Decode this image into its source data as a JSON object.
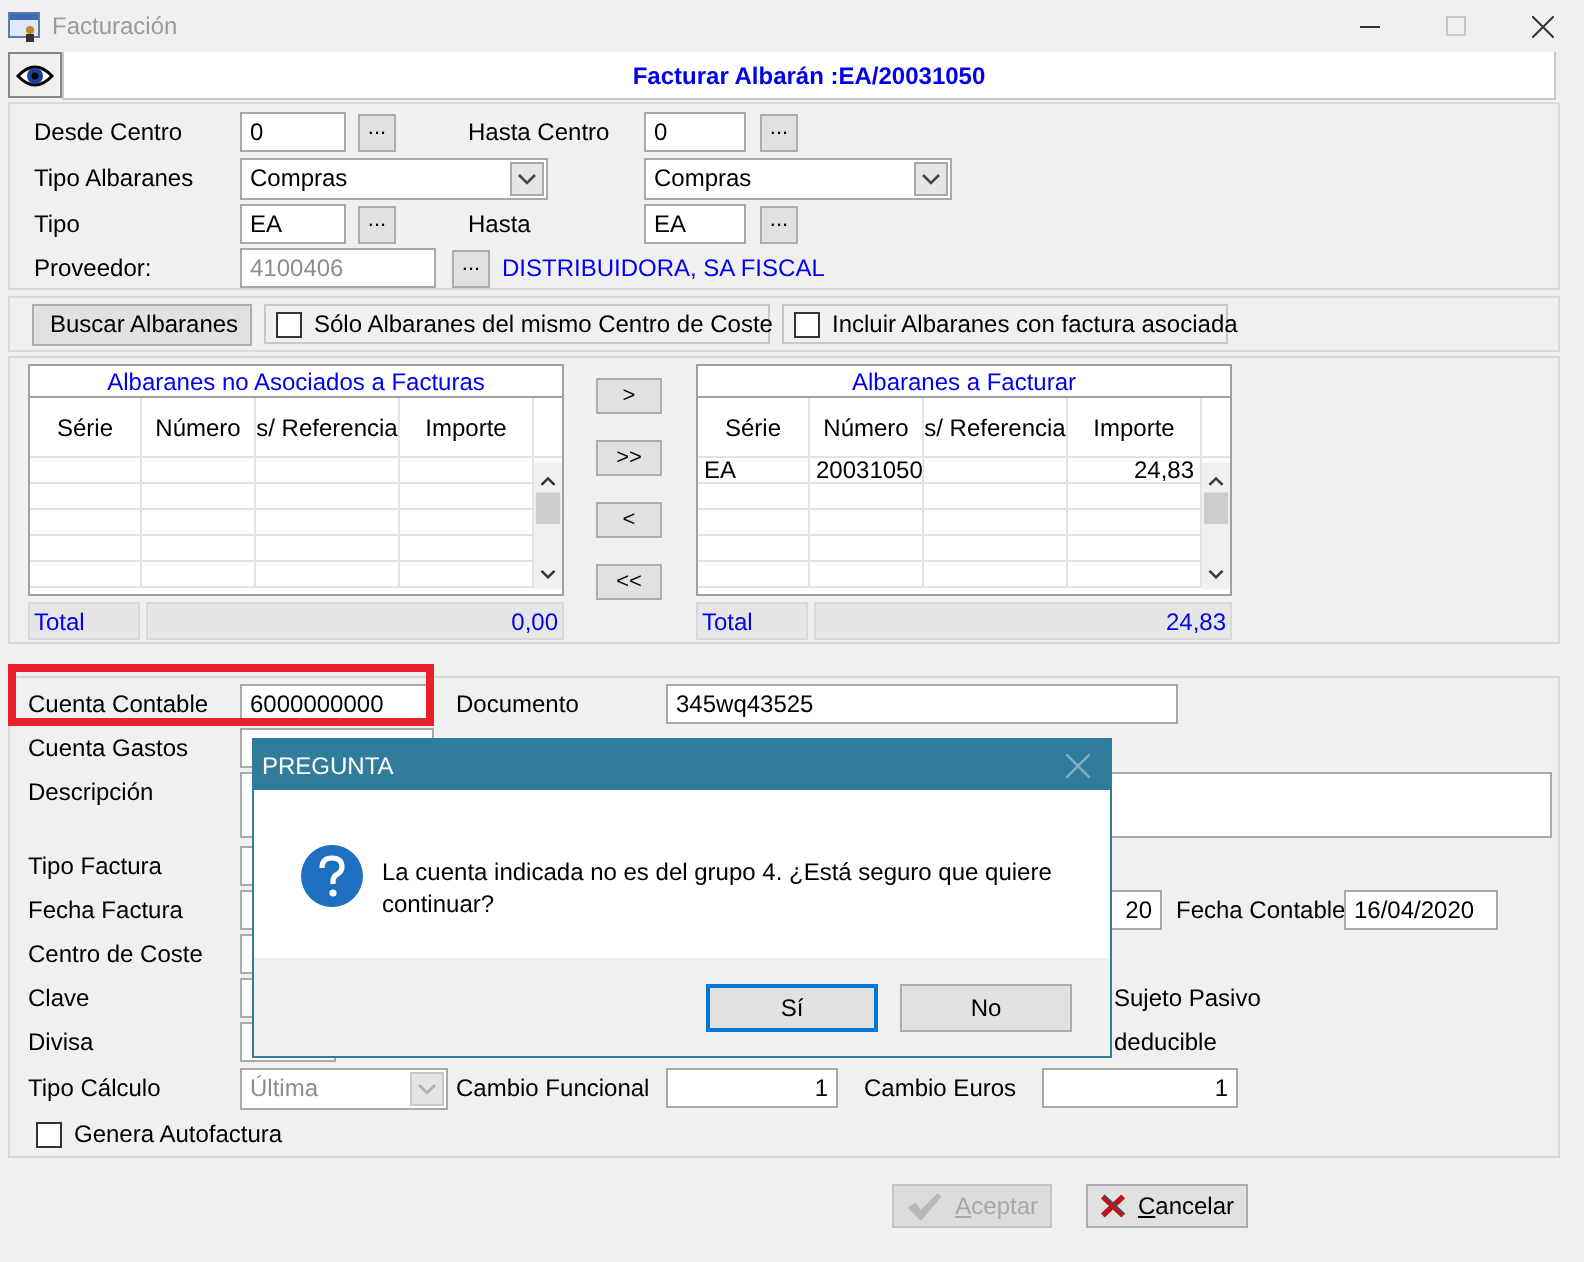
{
  "window": {
    "title": "Facturación"
  },
  "header": {
    "title": "Facturar Albarán :EA/20031050"
  },
  "filters": {
    "desde_centro": {
      "label": "Desde Centro",
      "value": "0",
      "button": "..."
    },
    "hasta_centro": {
      "label": "Hasta Centro",
      "value": "0",
      "button": "..."
    },
    "tipo_albaranes": {
      "label": "Tipo Albaranes",
      "value": "Compras"
    },
    "tipo_albaranes_hasta": {
      "value": "Compras"
    },
    "tipo": {
      "label": "Tipo",
      "value": "EA",
      "button": "..."
    },
    "hasta": {
      "label": "Hasta",
      "value": "EA",
      "button": "..."
    },
    "proveedor": {
      "label": "Proveedor:",
      "value": "4100406",
      "disabled": true,
      "button": "...",
      "name": "DISTRIBUIDORA, SA FISCAL"
    }
  },
  "search": {
    "button": "Buscar Albaranes",
    "options": [
      {
        "label": "Sólo Albaranes del mismo Centro de Coste",
        "checked": false
      },
      {
        "label": "Incluir Albaranes con factura asociada",
        "checked": false
      }
    ]
  },
  "lists": [
    {
      "title": "Albaranes no Asociados a Facturas",
      "columns": [
        "Série",
        "Número",
        "s/ Referencia",
        "Importe"
      ],
      "total_label": "Total",
      "total": "0,00"
    },
    {
      "title": "Albaranes a Facturar",
      "columns": [
        "Série",
        "Número",
        "s/ Referencia",
        "Importe"
      ],
      "rows": [
        {
          "serie": "EA",
          "numero": "20031050",
          "importe": "24,83"
        }
      ],
      "total_label": "Total",
      "total": "24,83"
    }
  ],
  "move_buttons": [
    ">",
    ">>",
    "<",
    "<<"
  ],
  "detail": {
    "cuenta_contable": {
      "label": "Cuenta Contable",
      "value": "6000000000",
      "highlighted": true
    },
    "documento": {
      "label": "Documento",
      "value": "345wq43525"
    },
    "cuenta_gastos": {
      "label": "Cuenta Gastos"
    },
    "descripcion": {
      "label": "Descripción"
    },
    "tipo_factura": {
      "label": "Tipo Factura"
    },
    "fecha_factura": {
      "label": "Fecha Factura"
    },
    "field_2": {
      "value": "20"
    },
    "fecha_contable": {
      "label": "Fecha Contable",
      "value": "16/04/2020"
    },
    "centro_de_coste": {
      "label": "Centro de Coste"
    },
    "clave": {
      "label": "Clave"
    },
    "option_1": {
      "label": "Sujeto Pasivo"
    },
    "divisa": {
      "label": "Divisa"
    },
    "option_2": {
      "label": "deducible"
    },
    "tipo_calculo": {
      "label": "Tipo Cálculo",
      "value": "Última",
      "disabled": true
    },
    "cambio_funcional": {
      "label": "Cambio Funcional",
      "value": "1"
    },
    "cambio_euros": {
      "label": "Cambio Euros",
      "value": "1"
    },
    "genera_autofactura": {
      "label": "Genera Autofactura",
      "checked": false
    }
  },
  "footer_buttons": [
    {
      "kind": "accept",
      "label": "Aceptar",
      "disabled": true
    },
    {
      "kind": "cancel",
      "label": "Cancelar",
      "disabled": false
    }
  ],
  "dialog": {
    "title": "PREGUNTA",
    "message": "La cuenta indicada no es del grupo 4. ¿Está seguro que quiere continuar?",
    "buttons": [
      {
        "label": "Sí",
        "selected": true
      },
      {
        "label": "No",
        "selected": false
      }
    ]
  }
}
